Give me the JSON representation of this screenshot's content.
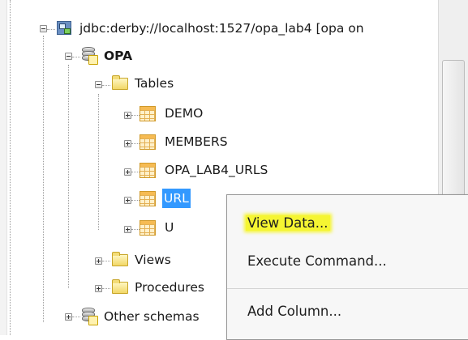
{
  "tree": {
    "connection": {
      "label": "jdbc:derby://localhost:1527/opa_lab4 [opa on"
    },
    "schema": {
      "label": "OPA"
    },
    "tables_folder": {
      "label": "Tables"
    },
    "tables": [
      {
        "label": "DEMO"
      },
      {
        "label": "MEMBERS"
      },
      {
        "label": "OPA_LAB4_URLS"
      },
      {
        "label": "URL"
      },
      {
        "label": "U"
      }
    ],
    "views_folder": {
      "label": "Views"
    },
    "procedures_folder": {
      "label": "Procedures"
    },
    "other_schemas": {
      "label": "Other schemas"
    }
  },
  "context_menu": {
    "items": [
      {
        "label": "View Data...",
        "highlighted": true
      },
      {
        "label": "Execute Command..."
      },
      {
        "label": "Add Column..."
      }
    ]
  }
}
